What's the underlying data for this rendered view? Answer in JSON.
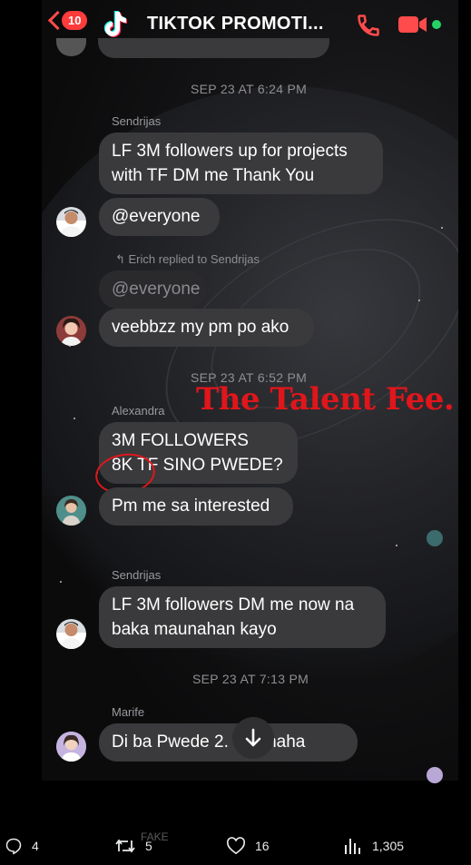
{
  "header": {
    "unread_count": "10",
    "title": "TIKTOK PROMOTI..."
  },
  "messages": {
    "date1": "SEP 23 AT 6:24 PM",
    "sender1": "Sendrijas",
    "msg1": "LF 3M followers up for projects\nwith TF DM me Thank You",
    "msg2": "@everyone",
    "reply_label": "Erich replied to Sendrijas",
    "reply_quote": "@everyone",
    "msg3": "veebbzz my pm po ako",
    "date2": "SEP 23 AT 6:52 PM",
    "sender2": "Alexandra",
    "msg4": "3M FOLLOWERS\n8K TF SINO PWEDE?",
    "msg5": "Pm me sa interested",
    "sender3": "Sendrijas",
    "msg6": "LF 3M followers DM me now na\nbaka maunahan kayo",
    "date3": "SEP 23 AT 7:13 PM",
    "sender4": "Marife",
    "msg7": "Di ba Pwede 2.  ahahaha"
  },
  "overlay_text": "The Talent Fee.",
  "footer": {
    "replies": "4",
    "retweets": "5",
    "likes": "16",
    "views": "1,305",
    "faded_label": "FAKE"
  },
  "colors": {
    "accent_red": "#ff3b3b",
    "overlay_red": "#e0161b",
    "online_green": "#26d367",
    "bubble": "#3a3a3c"
  }
}
